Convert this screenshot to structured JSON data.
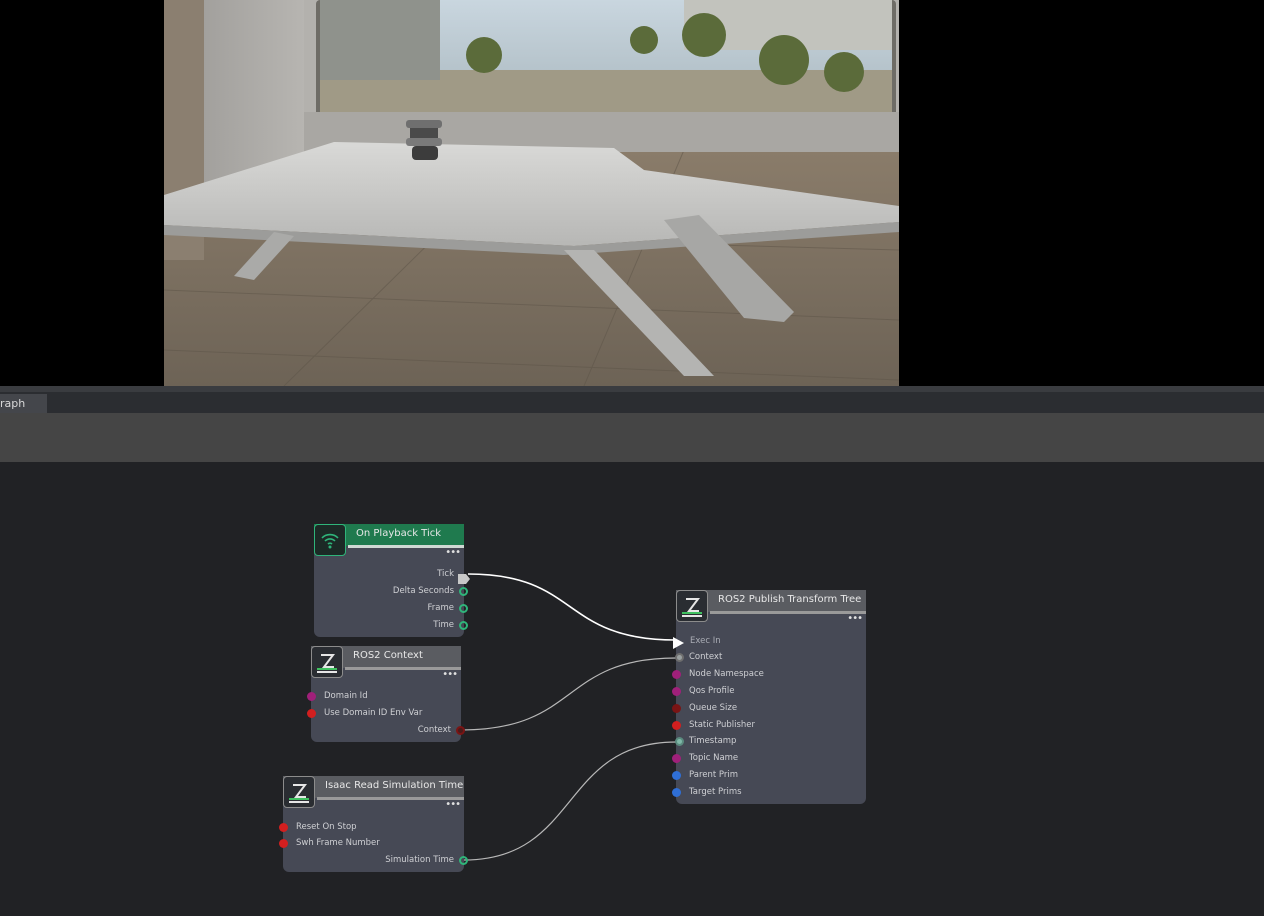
{
  "panel": {
    "tab_label": "raph"
  },
  "nodes": {
    "playback_tick": {
      "title": "On Playback Tick",
      "outputs": [
        "Tick",
        "Delta Seconds",
        "Frame",
        "Time"
      ]
    },
    "ros2_context": {
      "title": "ROS2 Context",
      "inputs": [
        "Domain Id",
        "Use Domain ID Env Var"
      ],
      "outputs": [
        "Context"
      ]
    },
    "read_sim_time": {
      "title": "Isaac Read Simulation Time",
      "inputs": [
        "Reset On Stop",
        "Swh Frame Number"
      ],
      "outputs": [
        "Simulation Time"
      ]
    },
    "publish_tf": {
      "title": "ROS2 Publish Transform Tree",
      "inputs": [
        "Exec In",
        "Context",
        "Node Namespace",
        "Qos Profile",
        "Queue Size",
        "Static Publisher",
        "Timestamp",
        "Topic Name",
        "Parent Prim",
        "Target Prims"
      ]
    }
  },
  "menu_dots": "•••",
  "colors": {
    "graph_bg": "#212225",
    "node_body": "#464955",
    "playback_header": "#1f7a4e",
    "pin_green": "#2fb57a",
    "pin_magenta": "#a0207a",
    "pin_red": "#d21f1f",
    "pin_darkred": "#7a1414",
    "pin_blue": "#2f6fd6",
    "pin_grey": "#9aa0a0"
  }
}
